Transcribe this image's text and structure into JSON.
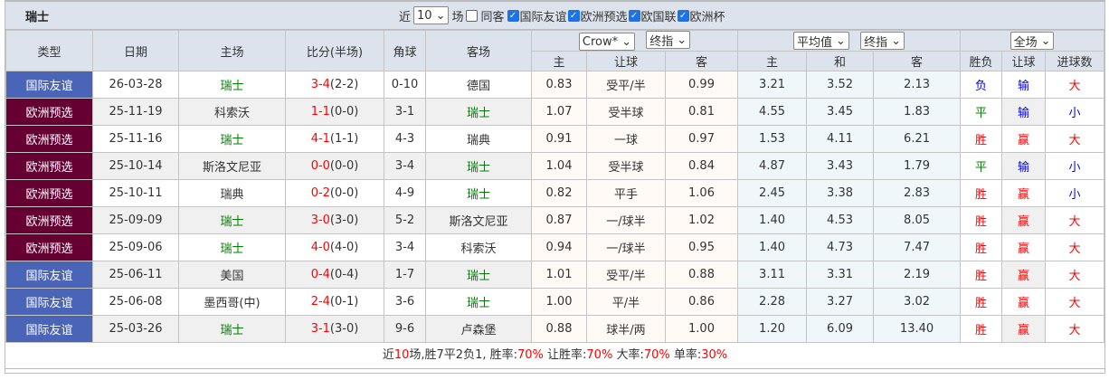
{
  "header": {
    "team": "瑞士",
    "near_label": "近",
    "count": "10",
    "games_label": "场",
    "same_home_label": "同客",
    "competitions": [
      {
        "label": "国际友谊",
        "checked": true
      },
      {
        "label": "欧洲预选",
        "checked": true
      },
      {
        "label": "欧国联",
        "checked": true
      },
      {
        "label": "欧洲杯",
        "checked": true
      }
    ]
  },
  "columns": {
    "type": "类型",
    "date": "日期",
    "home": "主场",
    "score": "比分(半场)",
    "corner": "角球",
    "away": "客场",
    "company_select": "Crow*",
    "ah_select": "终指",
    "avg_select": "平均值",
    "eu_select": "终指",
    "period_select": "全场",
    "ah": [
      "主",
      "让球",
      "客"
    ],
    "eu": [
      "主",
      "和",
      "客"
    ],
    "res": [
      "胜负",
      "让球",
      "进球数"
    ]
  },
  "colors": {
    "friendly": "#4a64b8",
    "euro_qual": "#660033",
    "win": "#ff0000",
    "draw": "#008000",
    "loss": "#0000ff",
    "team": "#008000"
  },
  "rows": [
    {
      "type": "国际友谊",
      "kind": "friendly",
      "date": "26-03-28",
      "home": "瑞士",
      "ft": "3-4",
      "ht": "(2-2)",
      "corner": "0-10",
      "away": "德国",
      "ah": [
        "0.83",
        "受平/半",
        "0.99"
      ],
      "eu": [
        "3.21",
        "3.52",
        "2.13"
      ],
      "wdl": "负",
      "hc": "输",
      "ou": "大"
    },
    {
      "type": "欧洲预选",
      "kind": "euro_qual",
      "date": "25-11-19",
      "home": "科索沃",
      "ft": "1-1",
      "ht": "(0-0)",
      "corner": "3-1",
      "away": "瑞士",
      "ah": [
        "1.07",
        "受半球",
        "0.81"
      ],
      "eu": [
        "4.55",
        "3.45",
        "1.83"
      ],
      "wdl": "平",
      "hc": "输",
      "ou": "小"
    },
    {
      "type": "欧洲预选",
      "kind": "euro_qual",
      "date": "25-11-16",
      "home": "瑞士",
      "ft": "4-1",
      "ht": "(1-1)",
      "corner": "4-3",
      "away": "瑞典",
      "ah": [
        "0.91",
        "一球",
        "0.97"
      ],
      "eu": [
        "1.53",
        "4.11",
        "6.21"
      ],
      "wdl": "胜",
      "hc": "赢",
      "ou": "大"
    },
    {
      "type": "欧洲预选",
      "kind": "euro_qual",
      "date": "25-10-14",
      "home": "斯洛文尼亚",
      "ft": "0-0",
      "ht": "(0-0)",
      "corner": "3-4",
      "away": "瑞士",
      "ah": [
        "1.04",
        "受半球",
        "0.84"
      ],
      "eu": [
        "4.87",
        "3.43",
        "1.79"
      ],
      "wdl": "平",
      "hc": "输",
      "ou": "小"
    },
    {
      "type": "欧洲预选",
      "kind": "euro_qual",
      "date": "25-10-11",
      "home": "瑞典",
      "ft": "0-2",
      "ht": "(0-0)",
      "corner": "4-9",
      "away": "瑞士",
      "ah": [
        "0.82",
        "平手",
        "1.06"
      ],
      "eu": [
        "2.45",
        "3.38",
        "2.83"
      ],
      "wdl": "胜",
      "hc": "赢",
      "ou": "小"
    },
    {
      "type": "欧洲预选",
      "kind": "euro_qual",
      "date": "25-09-09",
      "home": "瑞士",
      "ft": "3-0",
      "ht": "(3-0)",
      "corner": "5-2",
      "away": "斯洛文尼亚",
      "ah": [
        "0.87",
        "一/球半",
        "1.02"
      ],
      "eu": [
        "1.40",
        "4.53",
        "8.05"
      ],
      "wdl": "胜",
      "hc": "赢",
      "ou": "大"
    },
    {
      "type": "欧洲预选",
      "kind": "euro_qual",
      "date": "25-09-06",
      "home": "瑞士",
      "ft": "4-0",
      "ht": "(4-0)",
      "corner": "3-4",
      "away": "科索沃",
      "ah": [
        "0.94",
        "一/球半",
        "0.95"
      ],
      "eu": [
        "1.40",
        "4.73",
        "7.47"
      ],
      "wdl": "胜",
      "hc": "赢",
      "ou": "大"
    },
    {
      "type": "国际友谊",
      "kind": "friendly",
      "date": "25-06-11",
      "home": "美国",
      "ft": "0-4",
      "ht": "(0-4)",
      "corner": "1-7",
      "away": "瑞士",
      "ah": [
        "1.01",
        "受平/半",
        "0.88"
      ],
      "eu": [
        "3.11",
        "3.31",
        "2.19"
      ],
      "wdl": "胜",
      "hc": "赢",
      "ou": "大"
    },
    {
      "type": "国际友谊",
      "kind": "friendly",
      "date": "25-06-08",
      "home": "墨西哥(中)",
      "ft": "2-4",
      "ht": "(0-1)",
      "corner": "3-6",
      "away": "瑞士",
      "ah": [
        "1.00",
        "平/半",
        "0.86"
      ],
      "eu": [
        "2.28",
        "3.27",
        "3.02"
      ],
      "wdl": "胜",
      "hc": "赢",
      "ou": "大"
    },
    {
      "type": "国际友谊",
      "kind": "friendly",
      "date": "25-03-26",
      "home": "瑞士",
      "ft": "3-1",
      "ht": "(3-0)",
      "corner": "9-6",
      "away": "卢森堡",
      "ah": [
        "0.88",
        "球半/两",
        "1.00"
      ],
      "eu": [
        "1.20",
        "6.09",
        "13.40"
      ],
      "wdl": "胜",
      "hc": "赢",
      "ou": "大"
    }
  ],
  "summary": {
    "p1": "近",
    "n": "10",
    "p2": "场,胜7平2负1, 胜率:",
    "win": "70%",
    "p3": " 让胜率:",
    "hc": "70%",
    "p4": " 大率:",
    "over": "70%",
    "p5": " 单率:",
    "odd": "30%"
  }
}
